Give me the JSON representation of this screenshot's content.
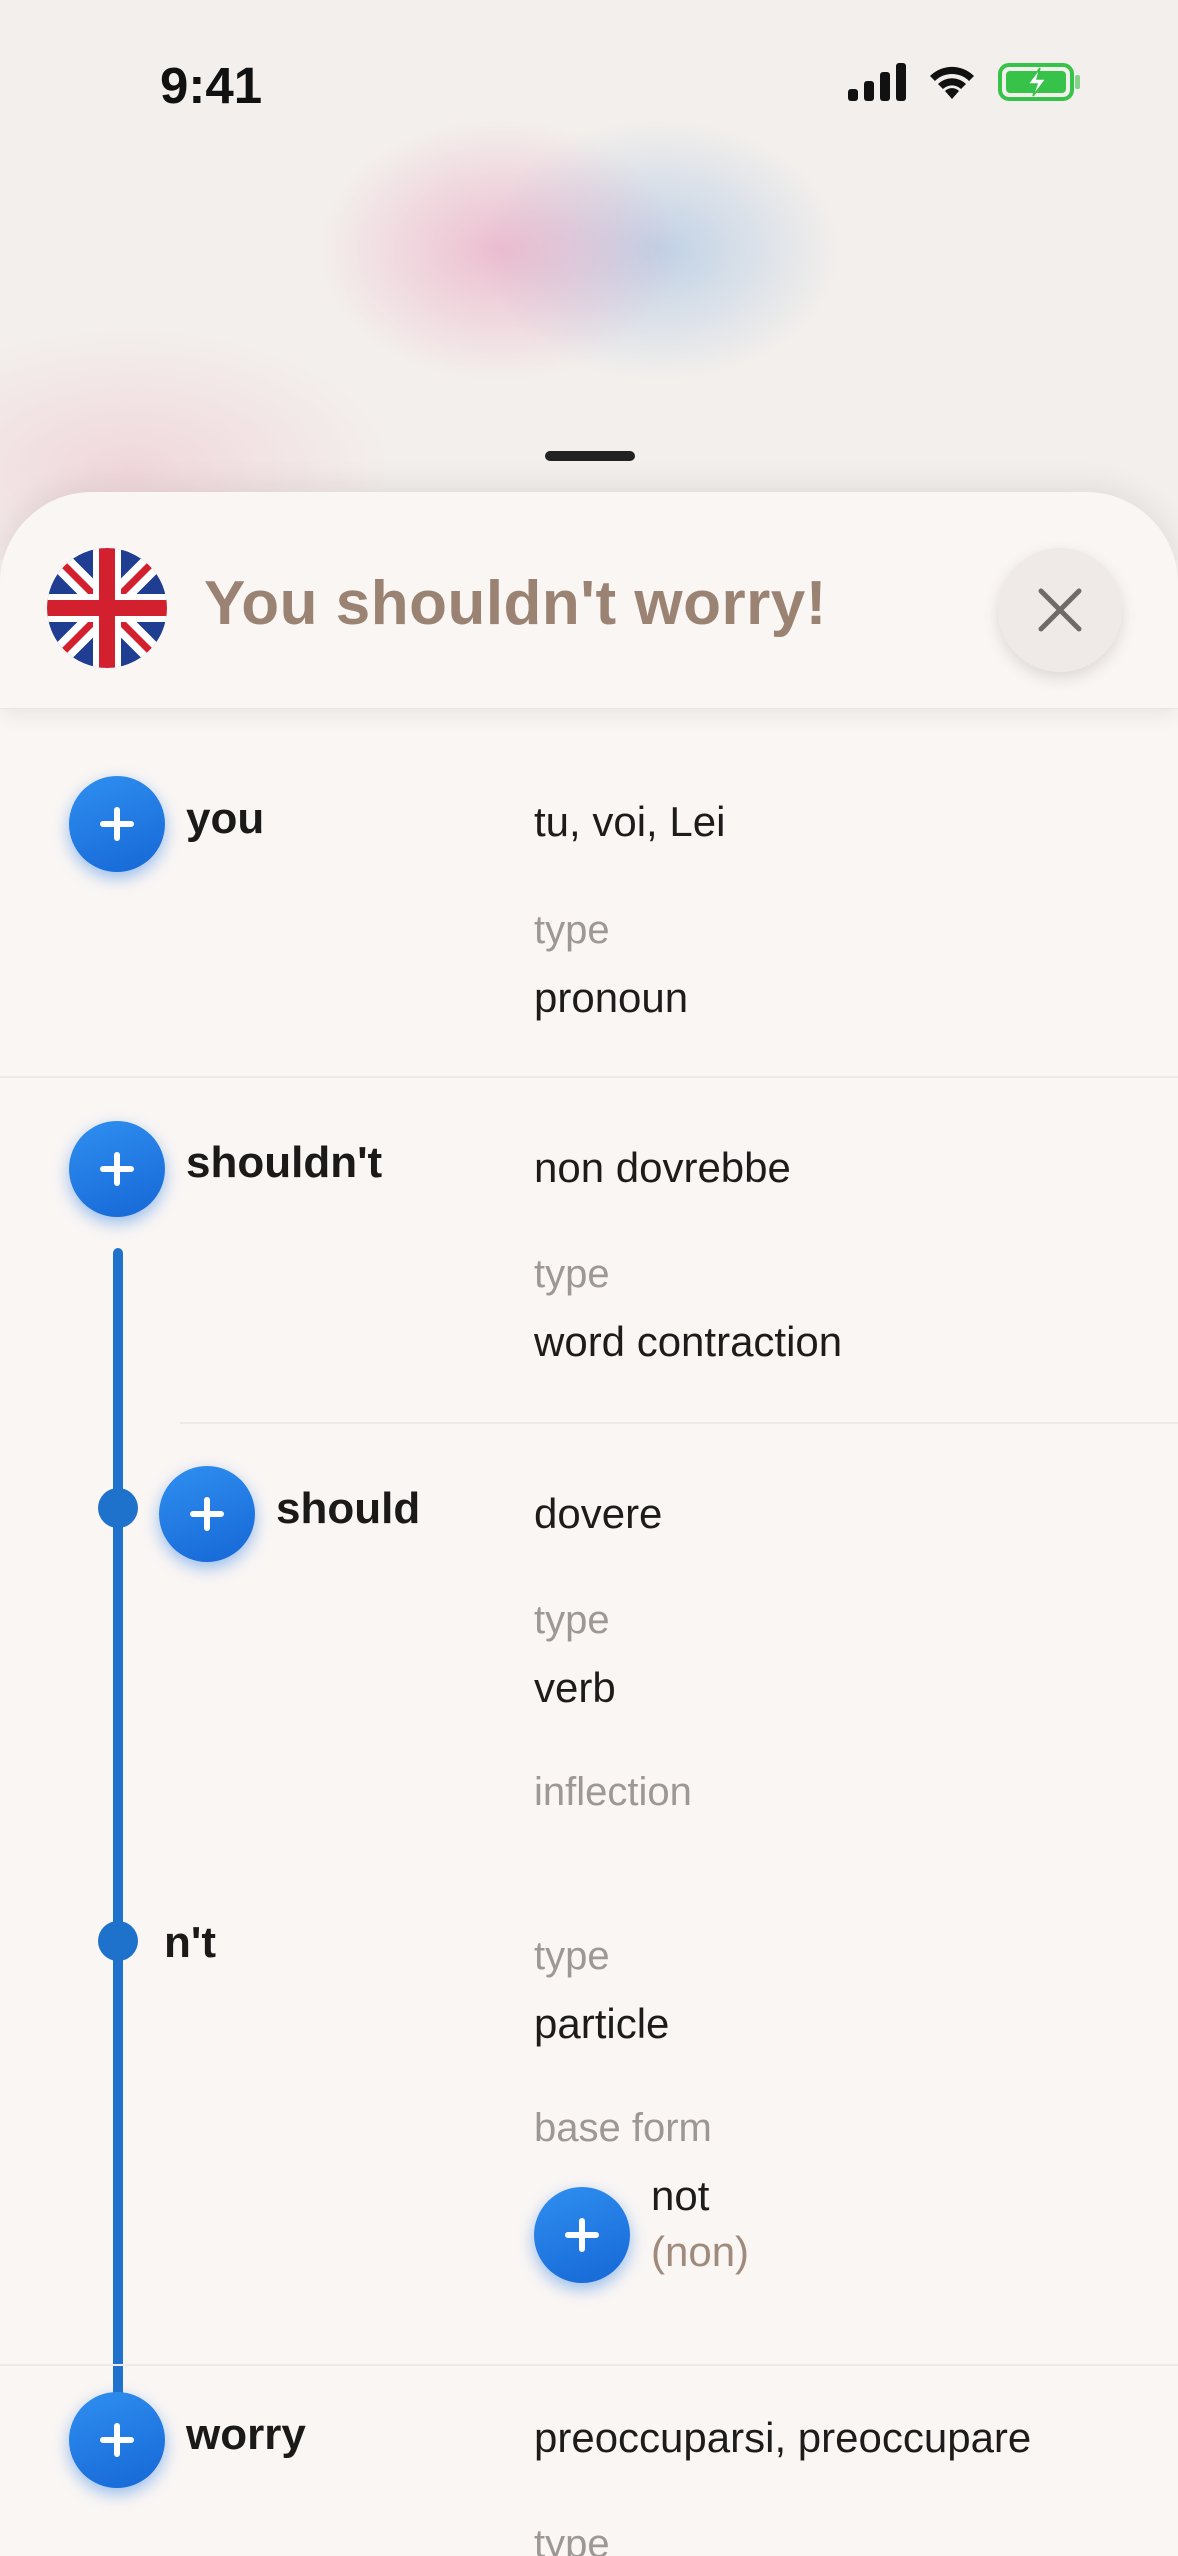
{
  "status_bar": {
    "time": "9:41"
  },
  "sheet": {
    "title": "You shouldn't worry!",
    "flag_icon": "uk-flag-icon",
    "close_icon": "close-icon"
  },
  "entries": {
    "you": {
      "word": "you",
      "translation": "tu, voi, Lei",
      "type_label": "type",
      "type_value": "pronoun"
    },
    "shouldnt": {
      "word": "shouldn't",
      "translation": "non dovrebbe",
      "type_label": "type",
      "type_value": "word contraction",
      "parts": {
        "should": {
          "word": "should",
          "translation": "dovere",
          "type_label": "type",
          "type_value": "verb",
          "inflection_label": "inflection"
        },
        "nt": {
          "word": "n't",
          "type_label": "type",
          "type_value": "particle",
          "base_form_label": "base form",
          "base_form_word": "not",
          "base_form_translation": "(non)"
        }
      }
    },
    "worry": {
      "word": "worry",
      "translation": "preoccuparsi, preoccupare",
      "type_label": "type"
    }
  },
  "colors": {
    "accent_blue": "#1f72cc",
    "title_brown": "#9b8373",
    "battery_green": "#37c24a"
  }
}
